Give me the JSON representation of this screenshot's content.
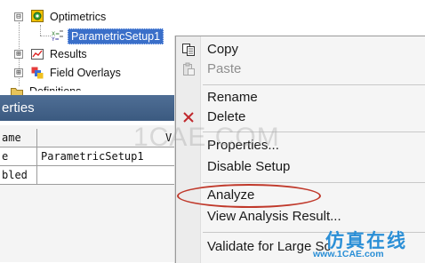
{
  "tree": {
    "items": [
      {
        "label": "Optimetrics",
        "expander": "⊟"
      },
      {
        "label": "ParametricSetup1",
        "selected": true
      },
      {
        "label": "Results",
        "expander": "⊞"
      },
      {
        "label": "Field Overlays",
        "expander": "⊞"
      },
      {
        "label": "Definitions",
        "expander": "⊞"
      }
    ]
  },
  "properties": {
    "title": "erties",
    "columns": [
      "ame",
      "V"
    ],
    "rows": [
      {
        "name": "e",
        "value": "ParametricSetup1"
      },
      {
        "name": "bled",
        "value": ""
      }
    ]
  },
  "context_menu": {
    "items": [
      {
        "label": "Copy",
        "icon": "copy-icon",
        "enabled": true
      },
      {
        "label": "Paste",
        "icon": "paste-icon",
        "enabled": false
      },
      {
        "label": "Rename",
        "enabled": true
      },
      {
        "label": "Delete",
        "icon": "delete-icon",
        "enabled": true
      },
      {
        "label": "Properties...",
        "enabled": true
      },
      {
        "label": "Disable Setup",
        "enabled": true
      },
      {
        "label": "Analyze",
        "enabled": true,
        "highlighted": true
      },
      {
        "label": "View Analysis Result...",
        "enabled": true
      },
      {
        "label": "Validate for Large Sc",
        "enabled": true
      }
    ],
    "highlight_color": "#c0392b"
  },
  "watermark": {
    "center": "1CAE.COM",
    "cn": "仿真在线",
    "url": "www.1CAE.com"
  }
}
